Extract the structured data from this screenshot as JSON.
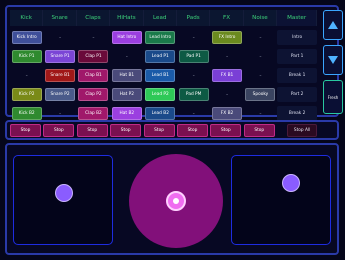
{
  "header": [
    "Kick",
    "Snare",
    "Claps",
    "HiHats",
    "Lead",
    "Pads",
    "FX",
    "Noise"
  ],
  "master_label": "Master",
  "rows": [
    {
      "cells": [
        "Kick Intro",
        "-",
        "-",
        "Hat Intro",
        "Lead Intro",
        "-",
        "FX Intro",
        "-"
      ],
      "master": "Intro"
    },
    {
      "cells": [
        "Kick P1",
        "Snare P1",
        "Clap P1",
        "-",
        "Lead P1",
        "Pad P1",
        "-",
        "-"
      ],
      "master": "Part 1"
    },
    {
      "cells": [
        "-",
        "Snare B1",
        "Clap B1",
        "Hat B1",
        "Lead B1",
        "-",
        "FX B1",
        "-"
      ],
      "master": "Break 1"
    },
    {
      "cells": [
        "Kick P2",
        "Snare P2",
        "Clap P2",
        "Hat P2",
        "Lead P2",
        "Pad PM",
        "-",
        "Spooky"
      ],
      "master": "Part 2"
    },
    {
      "cells": [
        "Kick B2",
        "-",
        "Clap B2",
        "Hat B2",
        "Lead B2",
        "-",
        "FX B2",
        "-"
      ],
      "master": "Break 2"
    }
  ],
  "colors": {
    "Kick": "#2f8a2f",
    "Snare": "#7b45d6",
    "Snare2": "#d62b2b",
    "Clap": "#b01068",
    "Hat": "#9b3fe0",
    "Lead": "#1a6ab8",
    "LeadActive": "#2ec957",
    "Pad": "#167a62",
    "FX": "#7a8a2a",
    "FX2": "#5a5aa0",
    "Spooky": "#3a4460"
  },
  "side": {
    "up": "up-arrow",
    "down": "down-arrow",
    "fresh": "Fresh"
  },
  "stop_labels": [
    "Stop",
    "Stop",
    "Stop",
    "Stop",
    "Stop",
    "Stop",
    "Stop",
    "Stop"
  ],
  "stop_all": "Stop All"
}
